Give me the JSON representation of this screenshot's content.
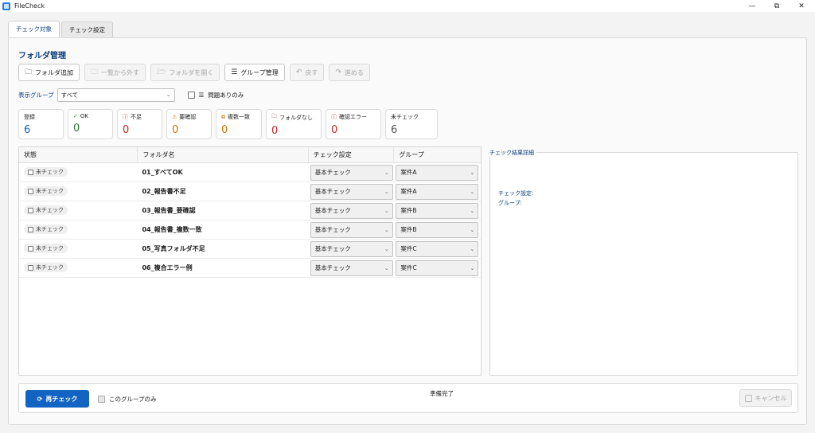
{
  "window": {
    "title": "FileCheck",
    "minimize": "—",
    "maximize": "⧉",
    "close": "✕"
  },
  "tabs": [
    {
      "label": "チェック対象"
    },
    {
      "label": "チェック設定"
    }
  ],
  "section_title": "フォルダ管理",
  "toolbar": {
    "add_folder": "フォルダ追加",
    "remove_from_list": "一覧から外す",
    "open_folder": "フォルダを開く",
    "group_manage": "グループ管理",
    "undo": "戻す",
    "redo": "進める"
  },
  "filter": {
    "label": "表示グループ",
    "value": "すべて",
    "problems_only": "問題ありのみ"
  },
  "cards": [
    {
      "label": "登録",
      "value": "6",
      "color": "#1a5fa8"
    },
    {
      "label": "OK",
      "value": "0",
      "color": "#2e7d32"
    },
    {
      "label": "不足",
      "value": "0",
      "color": "#c62828"
    },
    {
      "label": "要確認",
      "value": "0",
      "color": "#c77700"
    },
    {
      "label": "複数一致",
      "value": "0",
      "color": "#c77700"
    },
    {
      "label": "フォルダなし",
      "value": "0",
      "color": "#c62828"
    },
    {
      "label": "確認エラー",
      "value": "0",
      "color": "#c62828"
    },
    {
      "label": "未チェック",
      "value": "6",
      "color": "#555555"
    }
  ],
  "table": {
    "headers": [
      "状態",
      "フォルダ名",
      "チェック設定",
      "グループ"
    ],
    "rows": [
      {
        "status": "未チェック",
        "name": "01_すべてOK",
        "setting": "基本チェック",
        "group": "案件A"
      },
      {
        "status": "未チェック",
        "name": "02_報告書不足",
        "setting": "基本チェック",
        "group": "案件A"
      },
      {
        "status": "未チェック",
        "name": "03_報告書_要確認",
        "setting": "基本チェック",
        "group": "案件B"
      },
      {
        "status": "未チェック",
        "name": "04_報告書_複数一致",
        "setting": "基本チェック",
        "group": "案件B"
      },
      {
        "status": "未チェック",
        "name": "05_写真フォルダ不足",
        "setting": "基本チェック",
        "group": "案件C"
      },
      {
        "status": "未チェック",
        "name": "06_複合エラー例",
        "setting": "基本チェック",
        "group": "案件C"
      }
    ]
  },
  "detail": {
    "title": "チェック結果詳細",
    "setting_label": "チェック設定:",
    "group_label": "グループ:"
  },
  "bottom": {
    "recheck": "再チェック",
    "group_only": "このグループのみ",
    "status": "準備完了",
    "cancel": "キャンセル"
  }
}
